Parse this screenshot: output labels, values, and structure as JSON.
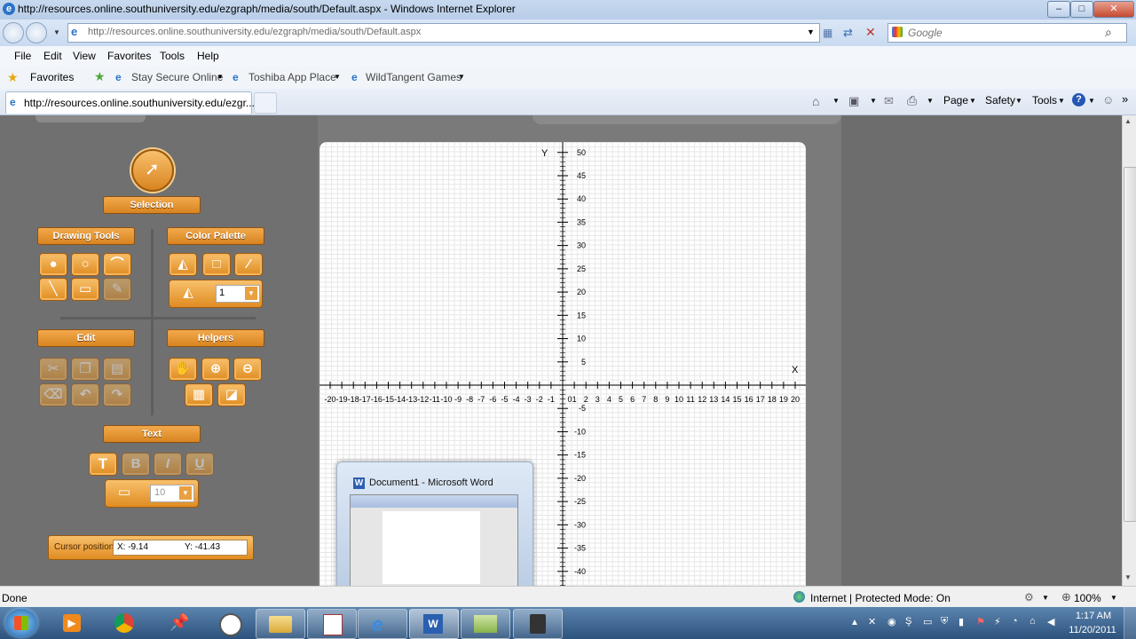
{
  "window": {
    "title": "http://resources.online.southuniversity.edu/ezgraph/media/south/Default.aspx - Windows Internet Explorer",
    "min_label": "–",
    "max_label": "□",
    "close_label": "✕"
  },
  "address": {
    "url": "http://resources.online.southuniversity.edu/ezgraph/media/south/Default.aspx",
    "search_placeholder": "Google"
  },
  "menu": [
    "File",
    "Edit",
    "View",
    "Favorites",
    "Tools",
    "Help"
  ],
  "favorites": {
    "label": "Favorites",
    "links": [
      "Stay Secure Online",
      "Toshiba App Place",
      "WildTangent Games"
    ]
  },
  "commandbar": [
    "Page",
    "Safety",
    "Tools"
  ],
  "tab": {
    "title": "http://resources.online.southuniversity.edu/ezgr..."
  },
  "tools": {
    "selection": "Selection",
    "drawing_tools": "Drawing Tools",
    "color_palette": "Color Palette",
    "edit": "Edit",
    "helpers": "Helpers",
    "text": "Text",
    "line_width": "1",
    "font_size": "10",
    "text_bold": "T",
    "text_b": "B",
    "text_i": "I",
    "text_u": "U",
    "cursor_label": "Cursor position",
    "cursor_x": "X: -9.14",
    "cursor_y": "Y: -41.43"
  },
  "graph": {
    "x_axis_label": "X",
    "y_axis_label": "Y",
    "x_ticks": [
      "-20",
      "-19",
      "-18",
      "-17",
      "-16",
      "-15",
      "-14",
      "-13",
      "-12",
      "-11",
      "-10",
      "-9",
      "-8",
      "-7",
      "-6",
      "-5",
      "-4",
      "-3",
      "-2",
      "-1",
      "0",
      "1",
      "2",
      "3",
      "4",
      "5",
      "6",
      "7",
      "8",
      "9",
      "10",
      "11",
      "12",
      "13",
      "14",
      "15",
      "16",
      "17",
      "18",
      "19",
      "20"
    ],
    "y_ticks_pos": [
      "50",
      "45",
      "40",
      "35",
      "30",
      "25",
      "20",
      "15",
      "10",
      "5"
    ],
    "y_ticks_neg": [
      "-5",
      "-10",
      "-15",
      "-20",
      "-25",
      "-30",
      "-35",
      "-40"
    ]
  },
  "word_preview": {
    "title": "Document1 - Microsoft Word"
  },
  "status": {
    "left": "Done",
    "zone": "Internet | Protected Mode: On",
    "zoom": "100%"
  },
  "clock": {
    "time": "1:17 AM",
    "date": "11/20/2011"
  }
}
